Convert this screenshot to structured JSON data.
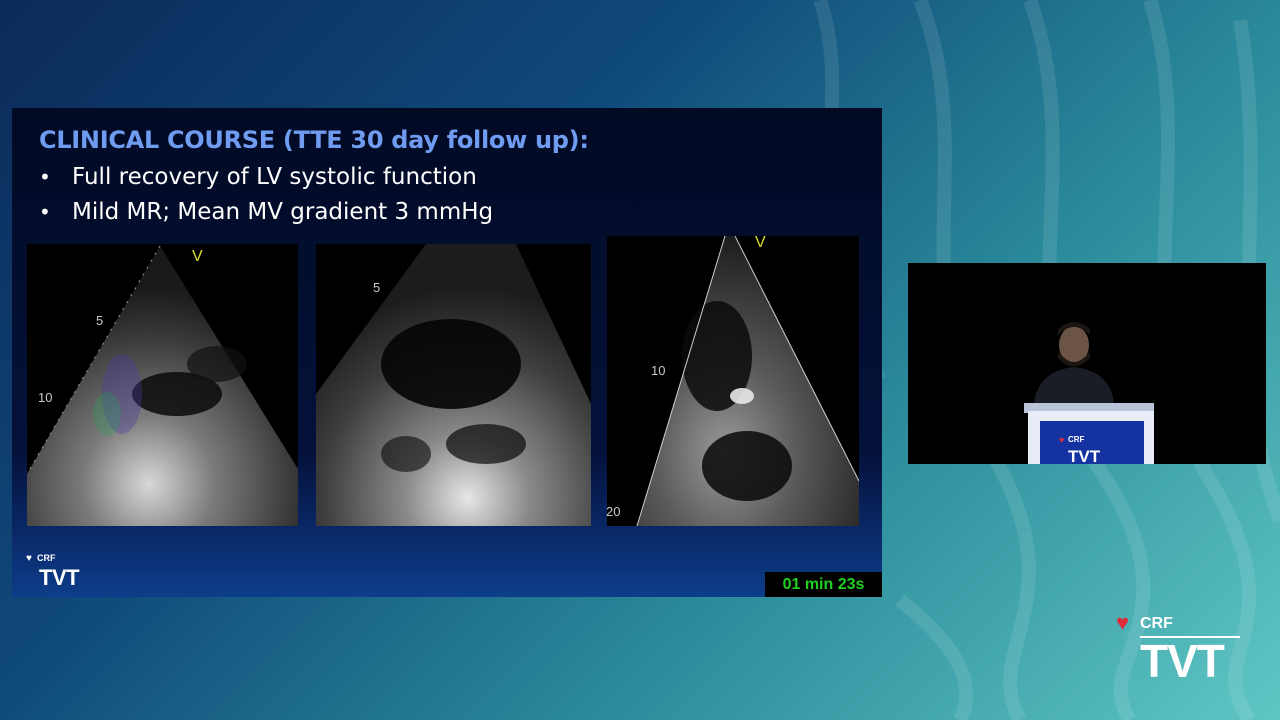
{
  "slide": {
    "title": "CLINICAL COURSE (TTE 30 day follow up):",
    "bullets": [
      "Full recovery of LV systolic function",
      "Mild MR; Mean MV gradient 3 mmHg"
    ],
    "echo_panels": [
      {
        "marker": "V",
        "depth_labels": [
          "5",
          "10"
        ]
      },
      {
        "marker": "",
        "depth_labels": [
          "5"
        ]
      },
      {
        "marker": "V",
        "depth_labels": [
          "10",
          "20"
        ]
      }
    ],
    "logo": {
      "brand": "CRF",
      "product": "TVT"
    }
  },
  "timer": {
    "text": "01 min 23s",
    "color": "#1fd11f"
  },
  "speaker_video": {
    "podium_logo": {
      "brand": "CRF",
      "product": "TVT"
    }
  },
  "corner_logo": {
    "brand": "CRF",
    "product": "TVT"
  },
  "colors": {
    "title_blue": "#6f9bf0",
    "heart_red": "#e02a3a",
    "background_teal": "#5fc6c4",
    "background_navy": "#0b2a5a"
  },
  "icons": [
    "heart-icon",
    "speaker-silhouette"
  ]
}
